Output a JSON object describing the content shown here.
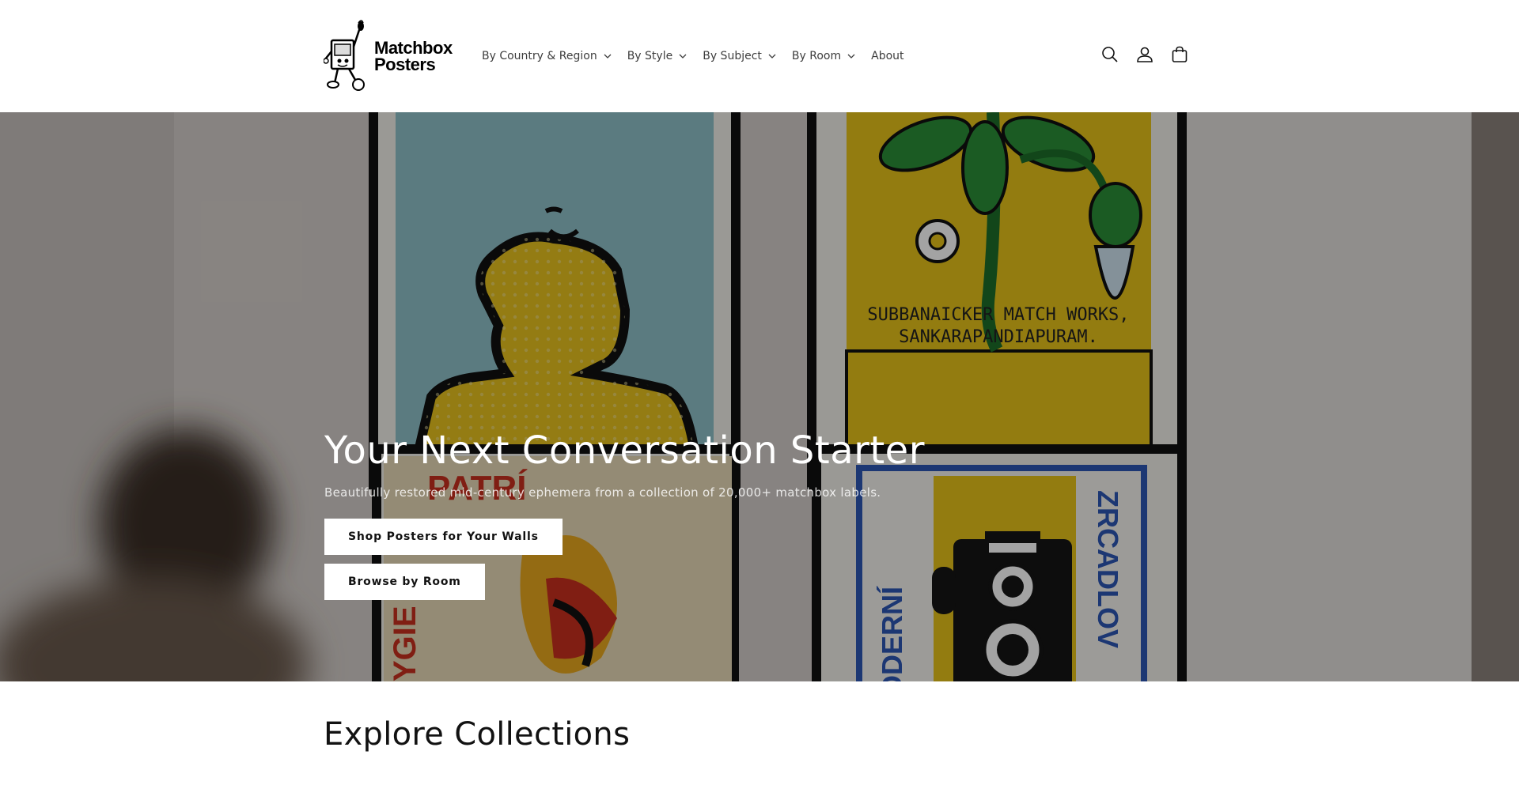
{
  "header": {
    "logo": {
      "line1": "Matchbox",
      "line2": "Posters"
    },
    "nav": [
      {
        "label": "By Country & Region",
        "has_dropdown": true
      },
      {
        "label": "By Style",
        "has_dropdown": true
      },
      {
        "label": "By Subject",
        "has_dropdown": true
      },
      {
        "label": "By Room",
        "has_dropdown": true
      },
      {
        "label": "About",
        "has_dropdown": false
      }
    ],
    "icons": [
      "search-icon",
      "account-icon",
      "cart-icon"
    ]
  },
  "hero": {
    "poster_texts": {
      "match_works_line1": "SUBBANAICKER MATCH WORKS,",
      "match_works_line2": "SANKARAPANDIAPURAM.",
      "moderni": "ODERNÍ",
      "zrcadlov": "ZRCADLOV",
      "patri": "PATRÍ",
      "ygi": "YGIE"
    },
    "title": "Your Next Conversation Starter",
    "subtitle": "Beautifully restored mid-century ephemera from a collection of 20,000+ matchbox labels.",
    "buttons": {
      "primary": "Shop Posters for Your Walls",
      "secondary": "Browse by Room"
    }
  },
  "collections": {
    "title": "Explore Collections"
  },
  "colors": {
    "overlay": "#000000",
    "button_bg": "#ffffff",
    "text": "#121212",
    "poster_yellow": "#e6c21a",
    "poster_blue": "#7fb6c4"
  }
}
